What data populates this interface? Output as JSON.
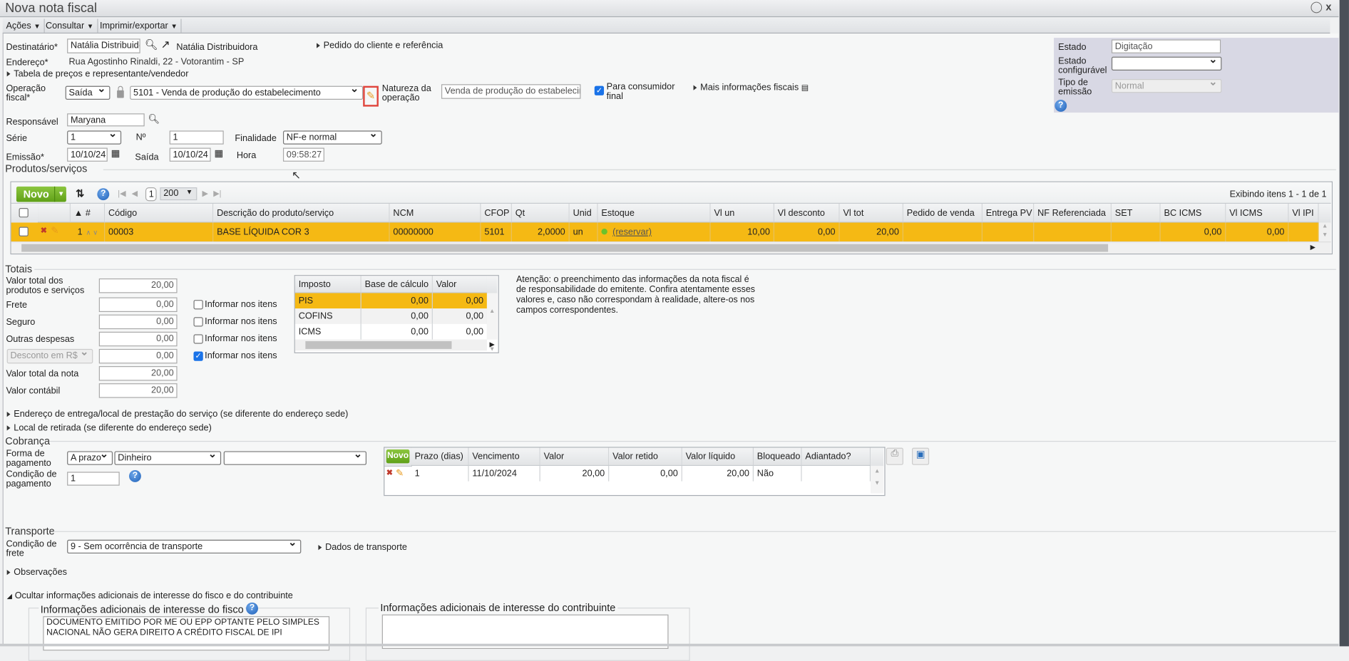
{
  "window": {
    "title": "Nova nota fiscal",
    "close": "x"
  },
  "toolbar": {
    "acoes": "Ações",
    "consultar": "Consultar",
    "imprimir": "Imprimir/exportar"
  },
  "header": {
    "destinatario_label": "Destinatário*",
    "destinatario_value": "Natália Distribuidora",
    "destinatario_link": "Natália Distribuidora",
    "pedido_link": "Pedido do cliente e referência",
    "endereco_label": "Endereço*",
    "endereco_value": "Rua Agostinho Rinaldi, 22 - Votorantim - SP",
    "tabela_link": "Tabela de preços e representante/vendedor",
    "operacao_label_1": "Operação",
    "operacao_label_2": "fiscal*",
    "operacao_tipo": "Saída",
    "operacao_value": "5101 - Venda de produção do estabelecimento",
    "natureza_label_1": "Natureza da",
    "natureza_label_2": "operação",
    "natureza_value": "Venda de produção do estabelecimento",
    "consumidor_label_1": "Para consumidor",
    "consumidor_label_2": "final",
    "consumidor_checked": true,
    "mais_info": "Mais informações fiscais",
    "responsavel_label": "Responsável",
    "responsavel_value": "Maryana",
    "serie_label": "Série",
    "serie_value": "1",
    "numero_label": "Nº",
    "numero_value": "1",
    "finalidade_label": "Finalidade",
    "finalidade_value": "NF-e normal",
    "emissao_label": "Emissão*",
    "emissao_value": "10/10/24",
    "saida_label": "Saída",
    "saida_value": "10/10/24",
    "hora_label": "Hora",
    "hora_value": "09:58:27"
  },
  "status_panel": {
    "estado_label": "Estado",
    "estado_value": "Digitação",
    "estado_conf_label_1": "Estado",
    "estado_conf_label_2": "configurável",
    "estado_conf_value": "",
    "tipo_label_1": "Tipo de",
    "tipo_label_2": "emissão",
    "tipo_value": "Normal"
  },
  "products": {
    "legend": "Produtos/serviços",
    "new_button": "Novo",
    "page": "1",
    "page_size": "200",
    "summary": "Exibindo itens 1 - 1 de 1",
    "columns": [
      "▲ #",
      "Código",
      "Descrição do produto/serviço",
      "NCM",
      "CFOP",
      "Qt",
      "Unid",
      "Estoque",
      "Vl un",
      "Vl desconto",
      "Vl tot",
      "Pedido de venda",
      "Entrega PV",
      "NF Referenciada",
      "SET",
      "BC ICMS",
      "Vl ICMS",
      "Vl IPI"
    ],
    "rows": [
      {
        "num": "1",
        "codigo": "00003",
        "descricao": "BASE LÍQUIDA COR 3",
        "ncm": "00000000",
        "cfop": "5101",
        "qt": "2,0000",
        "unid": "un",
        "estoque": "(reservar)",
        "vl_un": "10,00",
        "vl_desconto": "0,00",
        "vl_tot": "20,00",
        "pedido": "",
        "entrega": "",
        "nf_ref": "",
        "set": "",
        "bc_icms": "0,00",
        "vl_icms": "0,00",
        "vl_ipi": ""
      }
    ]
  },
  "totais": {
    "legend": "Totais",
    "valor_produtos_label_1": "Valor total dos",
    "valor_produtos_label_2": "produtos e serviços",
    "valor_produtos": "20,00",
    "frete_label": "Frete",
    "frete": "0,00",
    "seguro_label": "Seguro",
    "seguro": "0,00",
    "outras_label": "Outras despesas",
    "outras": "0,00",
    "desconto_tipo": "Desconto em R$",
    "desconto": "0,00",
    "valor_nota_label": "Valor total da nota",
    "valor_nota": "20,00",
    "valor_contabil_label": "Valor contábil",
    "valor_contabil": "20,00",
    "informar_label": "Informar nos itens",
    "informar_checked": [
      false,
      false,
      false,
      true
    ],
    "tax_columns": [
      "Imposto",
      "Base de cálculo",
      "Valor"
    ],
    "taxes": [
      {
        "imposto": "PIS",
        "base": "0,00",
        "valor": "0,00"
      },
      {
        "imposto": "COFINS",
        "base": "0,00",
        "valor": "0,00"
      },
      {
        "imposto": "ICMS",
        "base": "0,00",
        "valor": "0,00"
      }
    ],
    "aviso": "Atenção: o preenchimento das informações da nota fiscal é de responsabilidade do emitente. Confira atentamente esses valores e, caso não correspondam à realidade, altere-os nos campos correspondentes."
  },
  "links": {
    "entrega": "Endereço de entrega/local de prestação do serviço (se diferente do endereço sede)",
    "retirada": "Local de retirada (se diferente do endereço sede)"
  },
  "cobranca": {
    "legend": "Cobrança",
    "forma_label_1": "Forma de",
    "forma_label_2": "pagamento",
    "forma_tipo": "A prazo",
    "forma_meio": "Dinheiro",
    "forma_extra": "",
    "condicao_label_1": "Condição de",
    "condicao_label_2": "pagamento",
    "condicao_value": "1",
    "new_button": "Novo",
    "columns": [
      "Prazo (dias)",
      "Vencimento",
      "Valor",
      "Valor retido",
      "Valor líquido",
      "Bloqueado",
      "Adiantado?"
    ],
    "rows": [
      {
        "prazo": "1",
        "vencimento": "11/10/2024",
        "valor": "20,00",
        "retido": "0,00",
        "liquido": "20,00",
        "bloqueado": "Não",
        "adiantado": ""
      }
    ]
  },
  "transporte": {
    "legend": "Transporte",
    "frete_label_1": "Condição de",
    "frete_label_2": "frete",
    "frete_value": "9 - Sem ocorrência de transporte",
    "dados_link": "Dados de transporte"
  },
  "observacoes": "Observações",
  "info_adicional": {
    "toggle": "Ocultar informações adicionais de interesse do fisco e do contribuinte",
    "fisco_legend": "Informações adicionais de interesse do fisco",
    "fisco_text": "DOCUMENTO EMITIDO POR ME OU EPP OPTANTE PELO SIMPLES NACIONAL NÃO GERA DIREITO A CRÉDITO FISCAL DE IPI",
    "contribuinte_legend": "Informações adicionais de interesse do contribuinte",
    "contribuinte_text": ""
  },
  "colors": {
    "selected_row": "#f5b914",
    "accent_green": "#6aab1f",
    "status_panel": "#d8d8e4"
  }
}
